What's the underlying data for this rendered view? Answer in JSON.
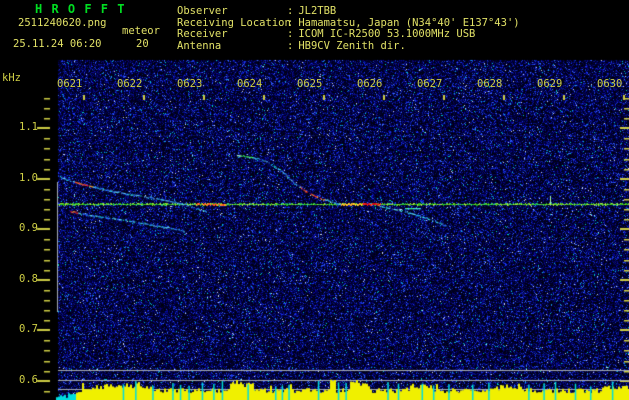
{
  "header": {
    "title": "H R O F F T",
    "filename": "2511240620.png",
    "mode": "meteor",
    "datetime": "25.11.24 06:20",
    "count": "20",
    "separator": ":",
    "info_rows": [
      {
        "label": "Observer",
        "value": "JL2TBB"
      },
      {
        "label": "Receiving Location",
        "value": "Hamamatsu, Japan (N34°40' E137°43')"
      },
      {
        "label": "Receiver",
        "value": "ICOM IC-R2500 53.1000MHz USB"
      },
      {
        "label": "Antenna",
        "value": "HB9CV Zenith dir."
      }
    ]
  },
  "colors": {
    "title_green": "#00dd22",
    "text_yellow": "#e0e066",
    "axis_yellow": "#cfcf45",
    "carrier_green": "#22bb22",
    "trace_cyan": "#33ccff",
    "hot_red": "#ff2222",
    "hot_orange": "#ff8822",
    "level_yellow": "#f0f000",
    "level_cyan": "#00dddd",
    "grid_gray": "#a8aeb6",
    "noise_blue": "#0000aa",
    "background": "#000000"
  },
  "chart_data": {
    "type": "heatmap",
    "subtype": "radio-meteor-spectrogram",
    "date": "25.11.24",
    "time_start": "06:20",
    "time_end": "06:30",
    "x_axis": {
      "description": "time (HHMM)",
      "ticks": [
        "0621",
        "0622",
        "0623",
        "0624",
        "0625",
        "0626",
        "0627",
        "0628",
        "0629",
        "0630"
      ],
      "span_seconds": 600
    },
    "y_axis": {
      "unit": "kHz",
      "ticks": [
        "1.1",
        "1.0",
        "0.9",
        "0.8",
        "0.7",
        "0.6"
      ],
      "minor_step_khz": 0.02,
      "range_khz": [
        0.575,
        1.17
      ]
    },
    "carrier": {
      "freq_khz": 0.95,
      "extent": "full-width horizontal line",
      "hot_segments": [
        {
          "t0": 145,
          "t1": 177,
          "style": "orange-red"
        },
        {
          "t0": 296,
          "t1": 320,
          "style": "yellow-orange"
        },
        {
          "t0": 320,
          "t1": 339,
          "style": "red"
        }
      ],
      "spike": {
        "t": 517,
        "f_top": 0.966
      }
    },
    "meteor_echoes": [
      {
        "name": "echo-0621-upper-branch",
        "color": "cyan",
        "points": [
          [
            2,
            1.004
          ],
          [
            21,
            0.992
          ],
          [
            55,
            0.976
          ],
          [
            97,
            0.964
          ],
          [
            133,
            0.95
          ],
          [
            155,
            0.936
          ]
        ],
        "hot_t": [
          17,
          36
        ]
      },
      {
        "name": "echo-0621-lower-branch",
        "color": "cyan",
        "points": [
          [
            13,
            0.936
          ],
          [
            34,
            0.928
          ],
          [
            65,
            0.92
          ],
          [
            97,
            0.91
          ],
          [
            133,
            0.897
          ]
        ],
        "hot_t": [
          13,
          21
        ]
      },
      {
        "name": "echo-0624-descending-curve",
        "color": "cyan",
        "points": [
          [
            188,
            1.047
          ],
          [
            204,
            1.043
          ],
          [
            219,
            1.035
          ],
          [
            231,
            1.021
          ],
          [
            241,
            1.005
          ],
          [
            249,
            0.99
          ],
          [
            260,
            0.976
          ],
          [
            272,
            0.964
          ],
          [
            286,
            0.956
          ],
          [
            296,
            0.95
          ]
        ],
        "bright_t": [
          188,
          205
        ],
        "hot_t": [
          254,
          280
        ]
      },
      {
        "name": "echo-0626-below-carrier-tail",
        "color": "cyan",
        "points": [
          [
            338,
            0.946
          ],
          [
            359,
            0.938
          ],
          [
            375,
            0.93
          ],
          [
            393,
            0.918
          ],
          [
            407,
            0.908
          ]
        ],
        "dash": {
          "t0": 365,
          "t1": 381,
          "f": 0.942
        }
      }
    ],
    "reference_lines_khz": [
      0.621,
      0.601,
      0.584
    ],
    "left_edge_marker_khz": [
      0.994,
      0.736
    ],
    "level_strip": {
      "label": "signal level",
      "cyan_until_t": 18,
      "envelope_boosts": [
        [
          34,
          97,
          4
        ],
        [
          179,
          204,
          7
        ],
        [
          284,
          292,
          10
        ],
        [
          305,
          326,
          8
        ],
        [
          368,
          393,
          5
        ],
        [
          459,
          486,
          3
        ],
        [
          570,
          600,
          3
        ]
      ],
      "marker_times_s": [
        68,
        81,
        99,
        120,
        128,
        137,
        151,
        163,
        172,
        199,
        228,
        235,
        242,
        273,
        294,
        302,
        346,
        357,
        382,
        394,
        410,
        435,
        452,
        494,
        510,
        522,
        543,
        559,
        582
      ]
    },
    "legend": "off",
    "grid": "off"
  }
}
